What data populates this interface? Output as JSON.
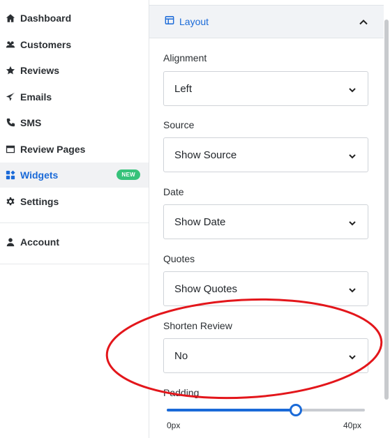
{
  "sidebar": {
    "items": [
      {
        "label": "Dashboard",
        "icon": "home-icon"
      },
      {
        "label": "Customers",
        "icon": "users-icon"
      },
      {
        "label": "Reviews",
        "icon": "star-icon"
      },
      {
        "label": "Emails",
        "icon": "send-icon"
      },
      {
        "label": "SMS",
        "icon": "phone-icon"
      },
      {
        "label": "Review Pages",
        "icon": "window-icon"
      },
      {
        "label": "Widgets",
        "icon": "widgets-icon",
        "badge": "NEW",
        "active": true
      },
      {
        "label": "Settings",
        "icon": "gear-icon"
      },
      {
        "label": "Account",
        "icon": "user-icon"
      }
    ]
  },
  "panel": {
    "header_title": "Layout",
    "fields": [
      {
        "label": "Alignment",
        "value": "Left"
      },
      {
        "label": "Source",
        "value": "Show Source"
      },
      {
        "label": "Date",
        "value": "Show Date"
      },
      {
        "label": "Quotes",
        "value": "Show Quotes"
      },
      {
        "label": "Shorten Review",
        "value": "No"
      }
    ],
    "padding": {
      "label": "Padding",
      "min": "0px",
      "max": "40px",
      "level_fraction": 0.65
    }
  },
  "colors": {
    "accent": "#1a6ad8",
    "badge": "#36c27a",
    "annotation": "#e3161b"
  }
}
